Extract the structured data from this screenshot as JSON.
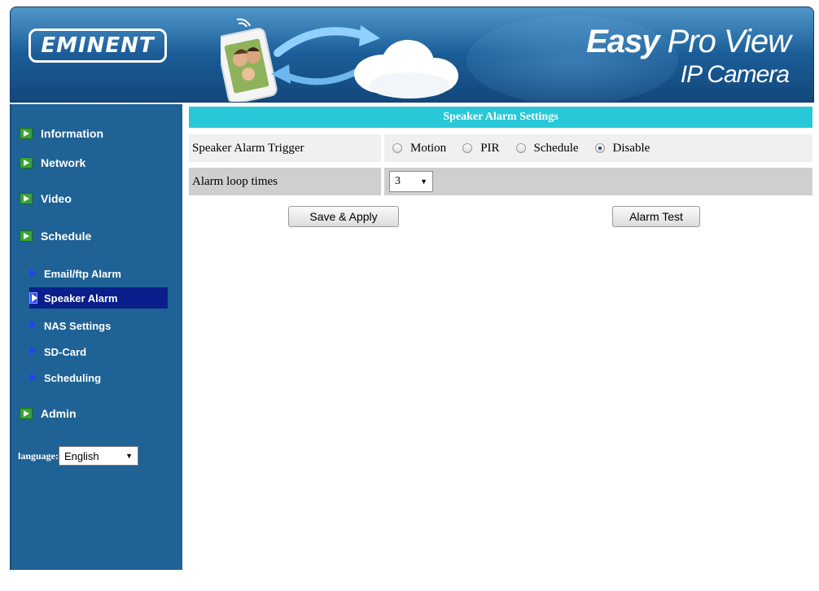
{
  "header": {
    "logo": "EMINENT",
    "title_bold": "Easy",
    "title_rest": "Pro View",
    "subtitle": "IP Camera"
  },
  "sidebar": {
    "main_items": [
      {
        "label": "Information"
      },
      {
        "label": "Network"
      },
      {
        "label": "Video"
      },
      {
        "label": "Schedule"
      },
      {
        "label": "Admin"
      }
    ],
    "sub_items": [
      {
        "label": "Email/ftp Alarm",
        "active": false
      },
      {
        "label": "Speaker Alarm",
        "active": true
      },
      {
        "label": "NAS Settings",
        "active": false
      },
      {
        "label": "SD-Card",
        "active": false
      },
      {
        "label": "Scheduling",
        "active": false
      }
    ],
    "language_label": "language:",
    "language_value": "English"
  },
  "main": {
    "section_title": "Speaker Alarm Settings",
    "trigger": {
      "label": "Speaker Alarm Trigger",
      "options": [
        "Motion",
        "PIR",
        "Schedule",
        "Disable"
      ],
      "selected": "Disable"
    },
    "loop": {
      "label": "Alarm loop times",
      "value": "3"
    },
    "save_button": "Save & Apply",
    "test_button": "Alarm Test"
  },
  "colors": {
    "banner": "#1b5f9a",
    "sidebar": "#1f6295",
    "section_header": "#28c8d8",
    "active_nav": "#0a1f8c"
  }
}
